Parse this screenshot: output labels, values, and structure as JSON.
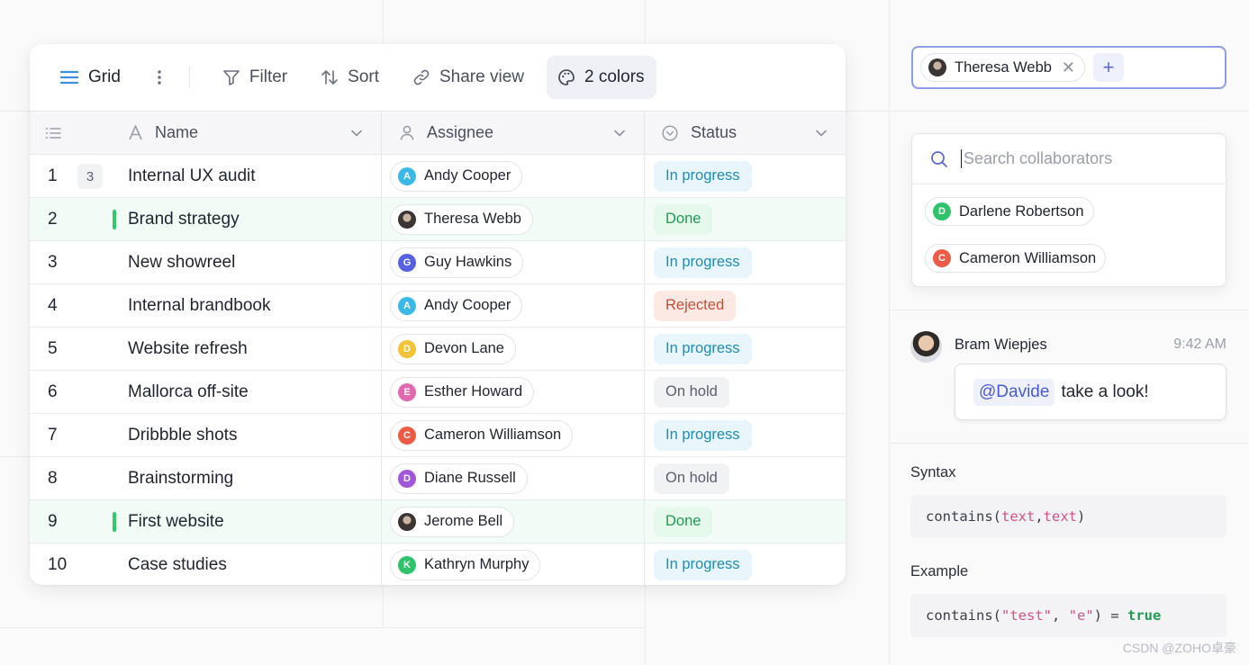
{
  "toolbar": {
    "view_label": "Grid",
    "filter_label": "Filter",
    "sort_label": "Sort",
    "share_label": "Share view",
    "colors_label": "2 colors"
  },
  "table": {
    "columns": {
      "name": "Name",
      "assignee": "Assignee",
      "status": "Status"
    },
    "first_row_count": "3",
    "rows": [
      {
        "num": "1",
        "name": "Internal UX audit",
        "assignee": "Andy Cooper",
        "initial": "A",
        "color": "#3bb8e6",
        "status": "In progress",
        "kind": "progress"
      },
      {
        "num": "2",
        "name": "Brand strategy",
        "assignee": "Theresa Webb",
        "initial": "",
        "color": "",
        "status": "Done",
        "kind": "done"
      },
      {
        "num": "3",
        "name": "New showreel",
        "assignee": "Guy Hawkins",
        "initial": "G",
        "color": "#5561e0",
        "status": "In progress",
        "kind": "progress"
      },
      {
        "num": "4",
        "name": "Internal brandbook",
        "assignee": "Andy Cooper",
        "initial": "A",
        "color": "#3bb8e6",
        "status": "Rejected",
        "kind": "rejected"
      },
      {
        "num": "5",
        "name": "Website refresh",
        "assignee": "Devon Lane",
        "initial": "D",
        "color": "#f2c237",
        "status": "In progress",
        "kind": "progress"
      },
      {
        "num": "6",
        "name": "Mallorca off-site",
        "assignee": "Esther Howard",
        "initial": "E",
        "color": "#e069b0",
        "status": "On hold",
        "kind": "hold"
      },
      {
        "num": "7",
        "name": "Dribbble shots",
        "assignee": "Cameron Williamson",
        "initial": "C",
        "color": "#ec5b46",
        "status": "In progress",
        "kind": "progress"
      },
      {
        "num": "8",
        "name": "Brainstorming",
        "assignee": "Diane Russell",
        "initial": "D",
        "color": "#a056d9",
        "status": "On hold",
        "kind": "hold"
      },
      {
        "num": "9",
        "name": "First website",
        "assignee": "Jerome Bell",
        "initial": "",
        "color": "",
        "status": "Done",
        "kind": "done"
      },
      {
        "num": "10",
        "name": "Case studies",
        "assignee": "Kathryn Murphy",
        "initial": "K",
        "color": "#2ec36a",
        "status": "In progress",
        "kind": "progress"
      }
    ]
  },
  "collaborator_input": {
    "selected": "Theresa Webb",
    "add_label": "+"
  },
  "collaborator_search": {
    "placeholder": "Search collaborators",
    "options": [
      {
        "name": "Darlene Robertson",
        "initial": "D",
        "color": "#2ec36a"
      },
      {
        "name": "Cameron Williamson",
        "initial": "C",
        "color": "#ec5b46"
      }
    ]
  },
  "comment": {
    "author": "Bram Wiepjes",
    "time": "9:42 AM",
    "mention": "@Davide",
    "text": "take a look!"
  },
  "formula": {
    "syntax_label": "Syntax",
    "syntax_fn": "contains(",
    "syntax_arg1": "text",
    "syntax_sep": ",",
    "syntax_arg2": "text",
    "syntax_close": ")",
    "example_label": "Example",
    "example_fn": "contains(",
    "example_arg1": "\"test\"",
    "example_sep": ", ",
    "example_arg2": "\"e\"",
    "example_close": ") = ",
    "example_result": "true"
  },
  "watermark": "CSDN @ZOHO卓豪"
}
